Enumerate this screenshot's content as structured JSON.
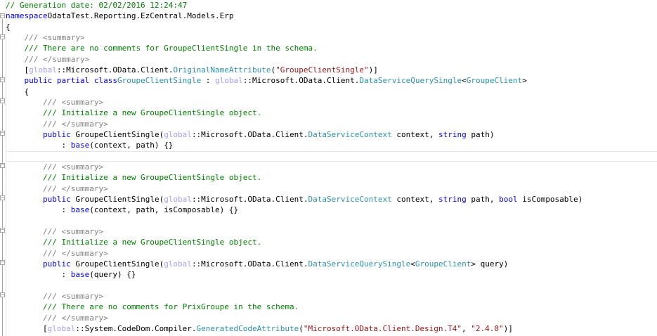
{
  "colors": {
    "keyword": "#0000ff",
    "comment": "#008000",
    "type": "#2b91af",
    "string": "#a31515",
    "global": "#a0a0ff"
  },
  "lines": [
    [
      [
        "cm",
        "// Generation date: 02/02/2016 12:24:47"
      ]
    ],
    [
      [
        "kw",
        "namespace"
      ],
      [
        "",
        "OdataTest.Reporting.EzCentral.Models.Erp"
      ]
    ],
    [
      [
        "",
        "{"
      ]
    ],
    [
      [
        "",
        "    "
      ],
      [
        "xml",
        "/// <summary>"
      ]
    ],
    [
      [
        "",
        "    "
      ],
      [
        "cm",
        "/// There are no comments for GroupeClientSingle in the schema."
      ]
    ],
    [
      [
        "",
        "    "
      ],
      [
        "xml",
        "/// </summary>"
      ]
    ],
    [
      [
        "",
        "    ["
      ],
      [
        "gl",
        "global"
      ],
      [
        "",
        "::Microsoft.OData.Client."
      ],
      [
        "ty",
        "OriginalNameAttribute"
      ],
      [
        "",
        "("
      ],
      [
        "st",
        "\"GroupeClientSingle\""
      ],
      [
        "",
        ")]"
      ]
    ],
    [
      [
        "",
        "    "
      ],
      [
        "kw",
        "public partial class"
      ],
      [
        "",
        ""
      ],
      [
        "ty",
        "GroupeClientSingle"
      ],
      [
        "",
        " : "
      ],
      [
        "gl",
        "global"
      ],
      [
        "",
        "::Microsoft.OData.Client."
      ],
      [
        "ty",
        "DataServiceQuerySingle"
      ],
      [
        "",
        "<"
      ],
      [
        "ty",
        "GroupeClient"
      ],
      [
        "",
        ">"
      ]
    ],
    [
      [
        "",
        "    {"
      ]
    ],
    [
      [
        "",
        "        "
      ],
      [
        "xml",
        "/// <summary>"
      ]
    ],
    [
      [
        "",
        "        "
      ],
      [
        "cm",
        "/// Initialize a new GroupeClientSingle object."
      ]
    ],
    [
      [
        "",
        "        "
      ],
      [
        "xml",
        "/// </summary>"
      ]
    ],
    [
      [
        "",
        "        "
      ],
      [
        "kw",
        "public"
      ],
      [
        "",
        " GroupeClientSingle("
      ],
      [
        "gl",
        "global"
      ],
      [
        "",
        "::Microsoft.OData.Client."
      ],
      [
        "ty",
        "DataServiceContext"
      ],
      [
        "",
        " context, "
      ],
      [
        "kw",
        "string"
      ],
      [
        "",
        " path)"
      ]
    ],
    [
      [
        "",
        "            : "
      ],
      [
        "kw",
        "base"
      ],
      [
        "",
        "(context, path) {}"
      ]
    ],
    [],
    [
      [
        "",
        "        "
      ],
      [
        "xml",
        "/// <summary>"
      ]
    ],
    [
      [
        "",
        "        "
      ],
      [
        "cm",
        "/// Initialize a new GroupeClientSingle object."
      ]
    ],
    [
      [
        "",
        "        "
      ],
      [
        "xml",
        "/// </summary>"
      ]
    ],
    [
      [
        "",
        "        "
      ],
      [
        "kw",
        "public"
      ],
      [
        "",
        " GroupeClientSingle("
      ],
      [
        "gl",
        "global"
      ],
      [
        "",
        "::Microsoft.OData.Client."
      ],
      [
        "ty",
        "DataServiceContext"
      ],
      [
        "",
        " context, "
      ],
      [
        "kw",
        "string"
      ],
      [
        "",
        " path, "
      ],
      [
        "kw",
        "bool"
      ],
      [
        "",
        " isComposable)"
      ]
    ],
    [
      [
        "",
        "            : "
      ],
      [
        "kw",
        "base"
      ],
      [
        "",
        "(context, path, isComposable) {}"
      ]
    ],
    [],
    [
      [
        "",
        "        "
      ],
      [
        "xml",
        "/// <summary>"
      ]
    ],
    [
      [
        "",
        "        "
      ],
      [
        "cm",
        "/// Initialize a new GroupeClientSingle object."
      ]
    ],
    [
      [
        "",
        "        "
      ],
      [
        "xml",
        "/// </summary>"
      ]
    ],
    [
      [
        "",
        "        "
      ],
      [
        "kw",
        "public"
      ],
      [
        "",
        " GroupeClientSingle("
      ],
      [
        "gl",
        "global"
      ],
      [
        "",
        "::Microsoft.OData.Client."
      ],
      [
        "ty",
        "DataServiceQuerySingle"
      ],
      [
        "",
        "<"
      ],
      [
        "ty",
        "GroupeClient"
      ],
      [
        "",
        "> query)"
      ]
    ],
    [
      [
        "",
        "            : "
      ],
      [
        "kw",
        "base"
      ],
      [
        "",
        "(query) {}"
      ]
    ],
    [],
    [
      [
        "",
        "        "
      ],
      [
        "xml",
        "/// <summary>"
      ]
    ],
    [
      [
        "",
        "        "
      ],
      [
        "cm",
        "/// There are no comments for PrixGroupe in the schema."
      ]
    ],
    [
      [
        "",
        "        "
      ],
      [
        "xml",
        "/// </summary>"
      ]
    ],
    [
      [
        "",
        "        ["
      ],
      [
        "gl",
        "global"
      ],
      [
        "",
        "::System.CodeDom.Compiler."
      ],
      [
        "ty",
        "GeneratedCodeAttribute"
      ],
      [
        "",
        "("
      ],
      [
        "st",
        "\"Microsoft.OData.Client.Design.T4\""
      ],
      [
        "",
        ", "
      ],
      [
        "st",
        "\"2.4.0\""
      ],
      [
        "",
        ")]"
      ]
    ]
  ]
}
